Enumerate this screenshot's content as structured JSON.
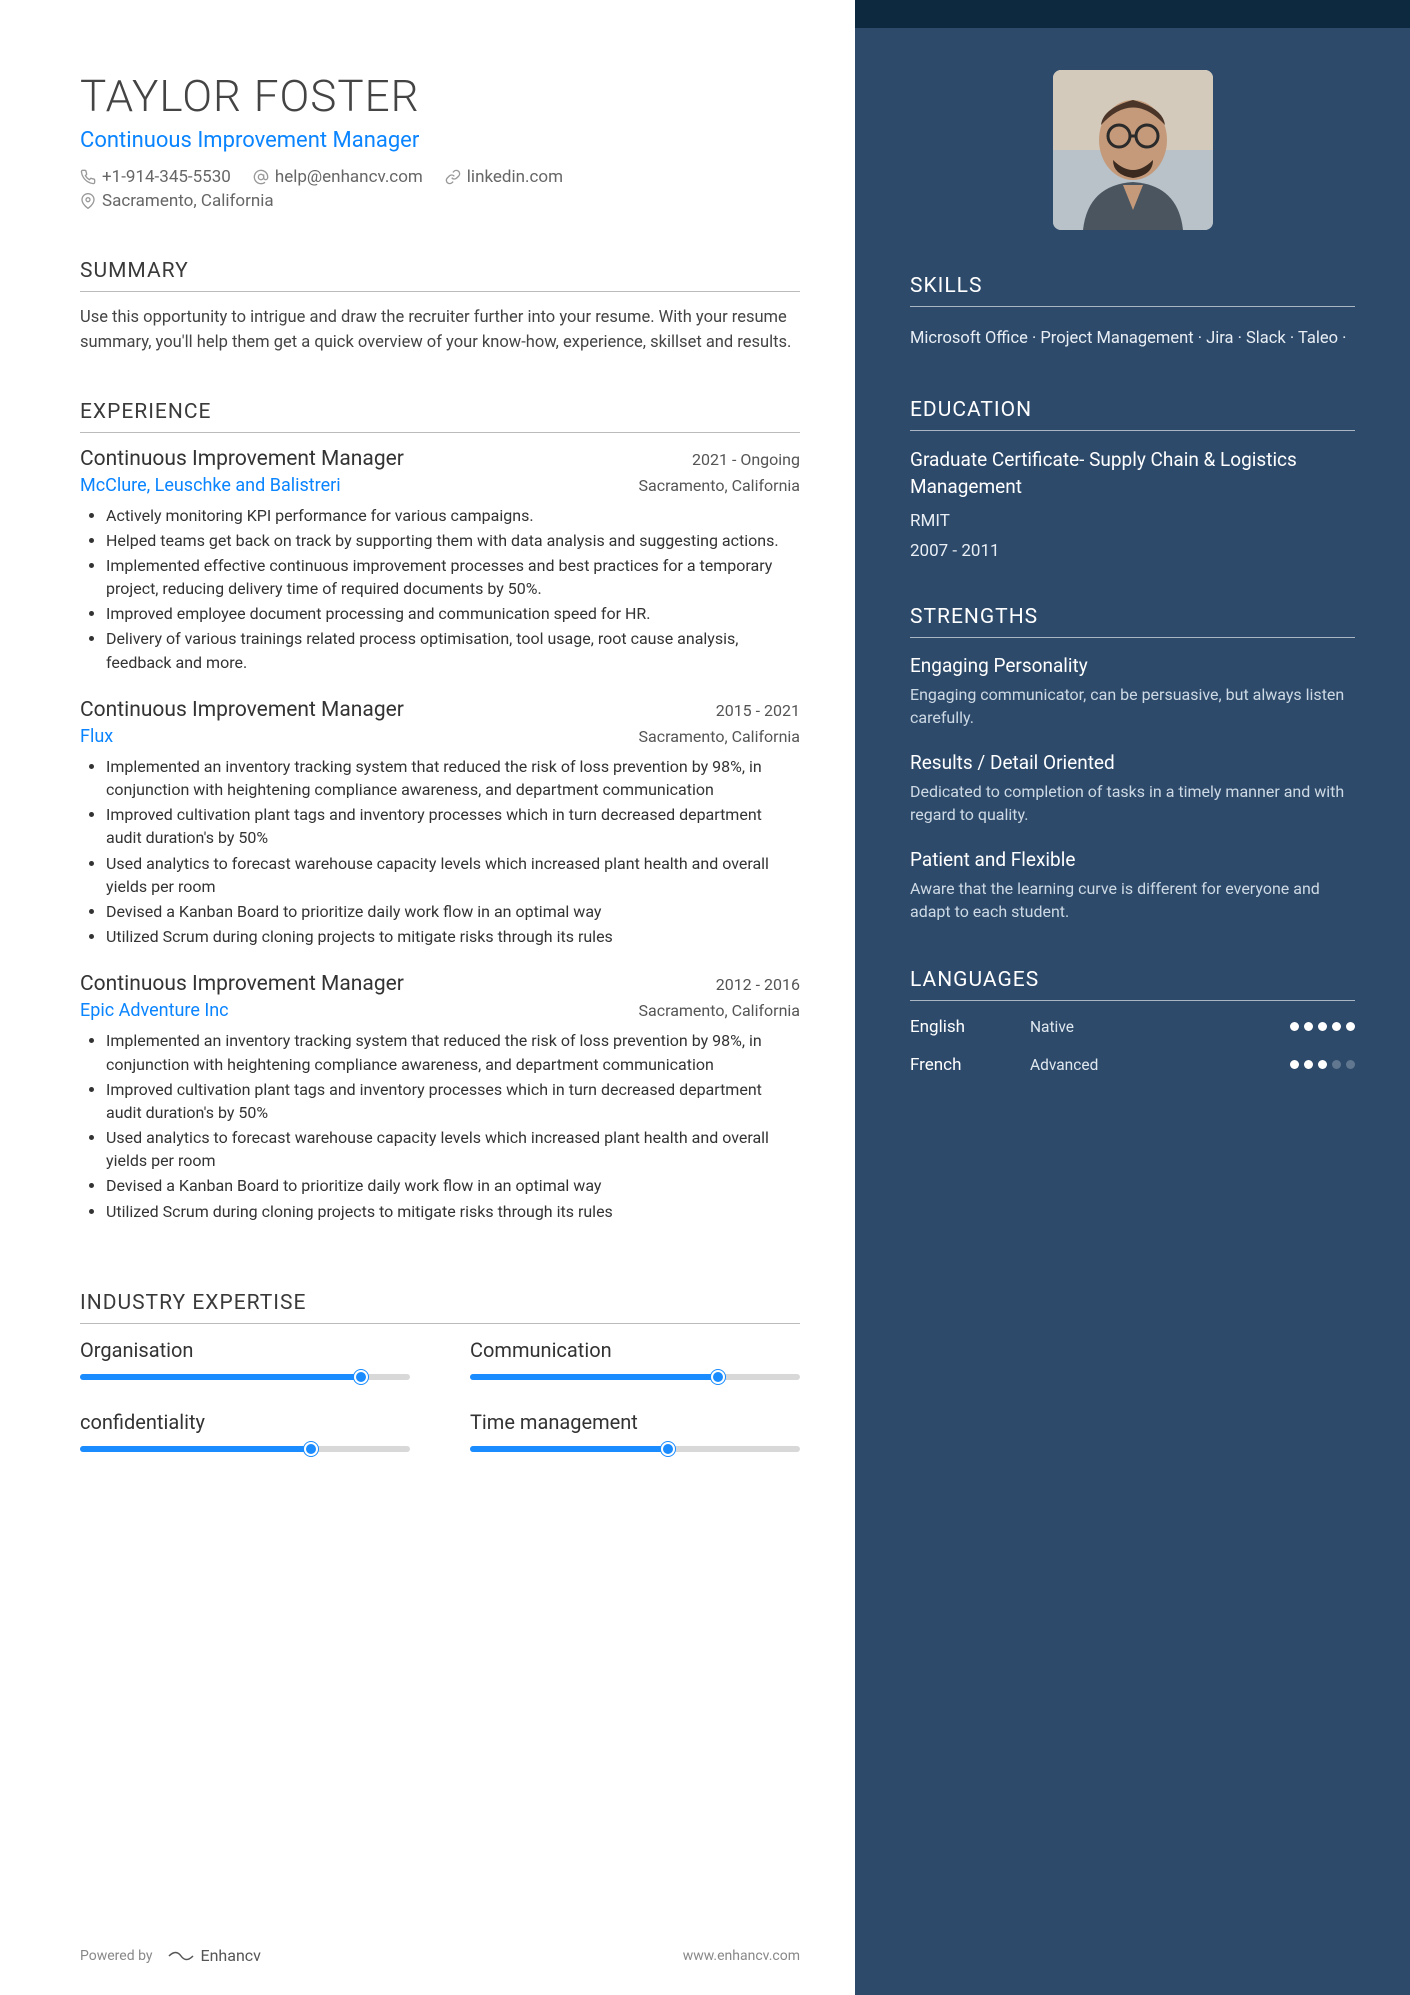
{
  "header": {
    "name": "TAYLOR FOSTER",
    "title": "Continuous Improvement Manager",
    "phone": "+1-914-345-5530",
    "email": "help@enhancv.com",
    "link": "linkedin.com",
    "location": "Sacramento, California"
  },
  "summary": {
    "heading": "SUMMARY",
    "text": "Use this opportunity to intrigue and draw the recruiter further into your resume. With your resume summary, you'll help them get a quick overview of your know-how, experience, skillset and results."
  },
  "experience": {
    "heading": "EXPERIENCE",
    "jobs": [
      {
        "title": "Continuous Improvement Manager",
        "dates": "2021 - Ongoing",
        "company": "McClure, Leuschke and Balistreri",
        "location": "Sacramento, California",
        "bullets": [
          "Actively monitoring KPI performance for various campaigns.",
          "Helped teams get back on track by supporting them with data analysis and suggesting actions.",
          "Implemented effective continuous improvement processes and best practices for a temporary project, reducing delivery time of required documents by 50%.",
          "Improved employee document processing and communication speed for HR.",
          "Delivery of various trainings related process optimisation, tool usage, root cause analysis, feedback and more."
        ]
      },
      {
        "title": "Continuous Improvement Manager",
        "dates": "2015 - 2021",
        "company": "Flux",
        "location": "Sacramento, California",
        "bullets": [
          "Implemented an inventory tracking system that reduced the risk of loss prevention by 98%, in conjunction with heightening compliance awareness, and department communication",
          "Improved cultivation plant tags and inventory processes which in turn decreased department audit duration's by 50%",
          "Used analytics to forecast warehouse capacity levels which increased plant health and overall yields per room",
          "Devised a Kanban Board to prioritize daily work flow in an optimal way",
          "Utilized Scrum during cloning projects to mitigate risks through its rules"
        ]
      },
      {
        "title": "Continuous Improvement Manager",
        "dates": "2012 - 2016",
        "company": "Epic Adventure Inc",
        "location": "Sacramento, California",
        "bullets": [
          "Implemented an inventory tracking system that reduced the risk of loss prevention by 98%, in conjunction with heightening compliance awareness, and department communication",
          "Improved cultivation plant tags and inventory processes which in turn decreased department audit duration's by 50%",
          "Used analytics to forecast warehouse capacity levels which increased plant health and overall yields per room",
          "Devised a Kanban Board to prioritize daily work flow in an optimal way",
          "Utilized Scrum during cloning projects to mitigate risks through its rules"
        ]
      }
    ]
  },
  "expertise": {
    "heading": "INDUSTRY EXPERTISE",
    "items": [
      {
        "label": "Organisation",
        "value": 85
      },
      {
        "label": "Communication",
        "value": 75
      },
      {
        "label": "confidentiality",
        "value": 70
      },
      {
        "label": "Time management",
        "value": 60
      }
    ]
  },
  "chart_data": {
    "type": "bar",
    "title": "Industry Expertise",
    "categories": [
      "Organisation",
      "Communication",
      "confidentiality",
      "Time management"
    ],
    "values": [
      85,
      75,
      70,
      60
    ],
    "xlabel": "",
    "ylabel": "",
    "ylim": [
      0,
      100
    ]
  },
  "sidebar": {
    "skills": {
      "heading": "SKILLS",
      "items": [
        "Microsoft Office",
        "Project Management",
        "Jira",
        "Slack",
        "Taleo"
      ]
    },
    "education": {
      "heading": "EDUCATION",
      "degree": "Graduate Certificate-   Supply Chain & Logistics Management",
      "school": "RMIT",
      "dates": "2007 - 2011"
    },
    "strengths": {
      "heading": "STRENGTHS",
      "items": [
        {
          "name": "Engaging Personality",
          "desc": "Engaging communicator, can be persuasive, but always listen carefully."
        },
        {
          "name": "Results / Detail Oriented",
          "desc": "Dedicated to completion of tasks in a timely manner and with regard to quality."
        },
        {
          "name": "Patient and Flexible",
          "desc": "Aware that the learning curve is different for everyone and adapt to each student."
        }
      ]
    },
    "languages": {
      "heading": "LANGUAGES",
      "items": [
        {
          "name": "English",
          "level": "Native",
          "score": 5
        },
        {
          "name": "French",
          "level": "Advanced",
          "score": 3
        }
      ]
    }
  },
  "footer": {
    "powered": "Powered by",
    "brand": "Enhancv",
    "url": "www.enhancv.com"
  }
}
